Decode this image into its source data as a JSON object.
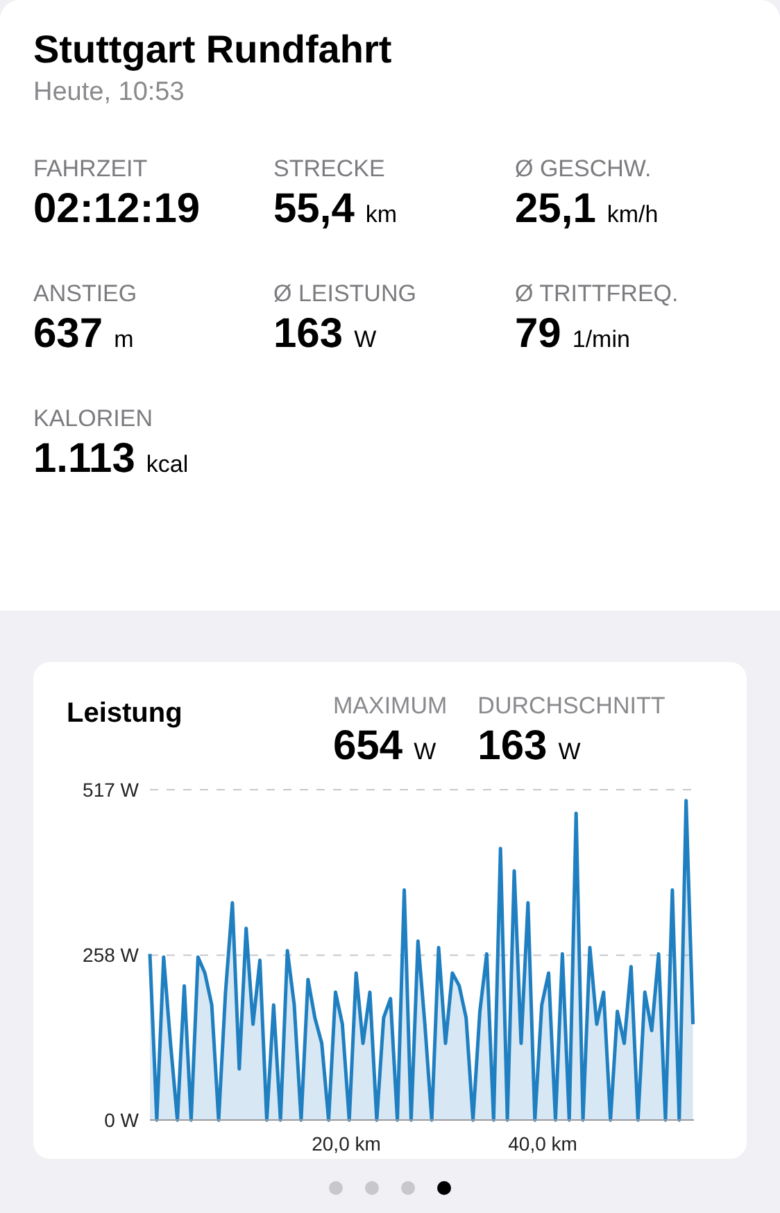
{
  "header": {
    "title": "Stuttgart Rundfahrt",
    "subtitle": "Heute, 10:53"
  },
  "metrics": [
    {
      "label": "FAHRZEIT",
      "value": "02:12:19"
    },
    {
      "label": "STRECKE",
      "value": "55,4",
      "unit": "km"
    },
    {
      "label": "Ø GESCHW.",
      "value": "25,1",
      "unit": "km/h"
    },
    {
      "label": "ANSTIEG",
      "value": "637",
      "unit": "m"
    },
    {
      "label": "Ø LEISTUNG",
      "value": "163",
      "unit": "W"
    },
    {
      "label": "Ø TRITTFREQ.",
      "value": "79",
      "unit": "1/min"
    },
    {
      "label": "KALORIEN",
      "value": "1.113",
      "unit": "kcal"
    }
  ],
  "power_card": {
    "title": "Leistung",
    "stats": [
      {
        "label": "MAXIMUM",
        "value": "654",
        "unit": "W"
      },
      {
        "label": "DURCHSCHNITT",
        "value": "163",
        "unit": "W"
      }
    ],
    "chart_data": {
      "type": "area",
      "xlim": [
        0,
        55.4
      ],
      "ylim": [
        0,
        517
      ],
      "yticks": [
        {
          "value": 0,
          "label": "0 W"
        },
        {
          "value": 258,
          "label": "258 W"
        },
        {
          "value": 517,
          "label": "517 W"
        }
      ],
      "xticks": [
        {
          "value": 20,
          "label": "20,0 km"
        },
        {
          "value": 40,
          "label": "40,0 km"
        }
      ],
      "x": [
        0,
        0.7,
        1.4,
        2.1,
        2.8,
        3.5,
        4.2,
        4.9,
        5.6,
        6.3,
        7,
        7.7,
        8.4,
        9.1,
        9.8,
        10.5,
        11.2,
        11.9,
        12.6,
        13.3,
        14,
        14.7,
        15.4,
        16.1,
        16.8,
        17.5,
        18.2,
        18.9,
        19.6,
        20.3,
        21,
        21.7,
        22.4,
        23.1,
        23.8,
        24.5,
        25.2,
        25.9,
        26.6,
        27.3,
        28,
        28.7,
        29.4,
        30.1,
        30.8,
        31.5,
        32.2,
        32.9,
        33.6,
        34.3,
        35,
        35.7,
        36.4,
        37.1,
        37.8,
        38.5,
        39.2,
        39.9,
        40.6,
        41.3,
        42,
        42.7,
        43.4,
        44.1,
        44.8,
        45.5,
        46.2,
        46.9,
        47.6,
        48.3,
        49,
        49.7,
        50.4,
        51.1,
        51.8,
        52.5,
        53.2,
        53.9,
        54.6,
        55.3
      ],
      "series": [
        {
          "color": "#1f7fc0",
          "values": [
            260,
            0,
            255,
            120,
            0,
            210,
            0,
            255,
            230,
            180,
            0,
            200,
            340,
            80,
            300,
            150,
            250,
            0,
            180,
            0,
            265,
            180,
            0,
            220,
            160,
            120,
            0,
            200,
            150,
            0,
            230,
            120,
            200,
            0,
            160,
            190,
            0,
            360,
            0,
            280,
            150,
            0,
            270,
            120,
            230,
            210,
            160,
            0,
            170,
            260,
            0,
            425,
            0,
            390,
            120,
            340,
            0,
            180,
            230,
            0,
            260,
            0,
            480,
            0,
            270,
            150,
            200,
            0,
            170,
            120,
            240,
            0,
            200,
            140,
            260,
            0,
            360,
            0,
            500,
            150
          ]
        }
      ]
    }
  },
  "pager": [
    {
      "selected": false
    },
    {
      "selected": false
    },
    {
      "selected": false
    },
    {
      "selected": true
    }
  ]
}
